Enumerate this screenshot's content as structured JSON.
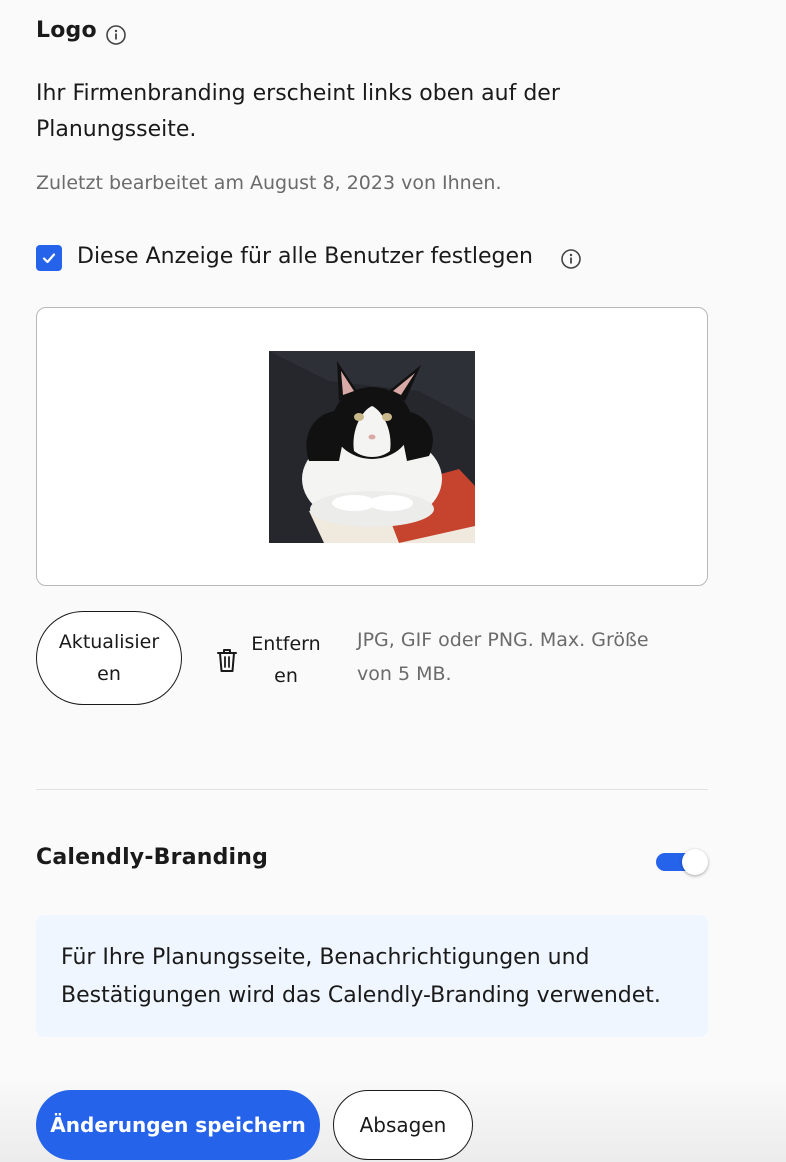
{
  "logo_section": {
    "title": "Logo",
    "description": "Ihr Firmenbranding erscheint links oben auf der Planungsseite.",
    "last_edited": "Zuletzt bearbeitet am August 8, 2023 von Ihnen.",
    "checkbox_label": "Diese Anzeige für alle Benutzer festlegen",
    "checkbox_checked": true,
    "update_button": "Aktualisieren",
    "remove_button": "Entfernen",
    "file_hint": "JPG, GIF oder PNG. Max. Größe von 5 MB."
  },
  "branding_section": {
    "title": "Calendly-Branding",
    "toggle_on": true,
    "info_text": "Für Ihre Planungsseite, Benachrichtigungen und Bestätigungen wird das Calendly-Branding verwendet."
  },
  "footer": {
    "save_button": "Änderungen speichern",
    "cancel_button": "Absagen"
  },
  "colors": {
    "accent": "#2563eb",
    "info_bg": "#f0f6ff"
  },
  "icons": [
    "info-icon",
    "check-icon",
    "trash-icon"
  ]
}
